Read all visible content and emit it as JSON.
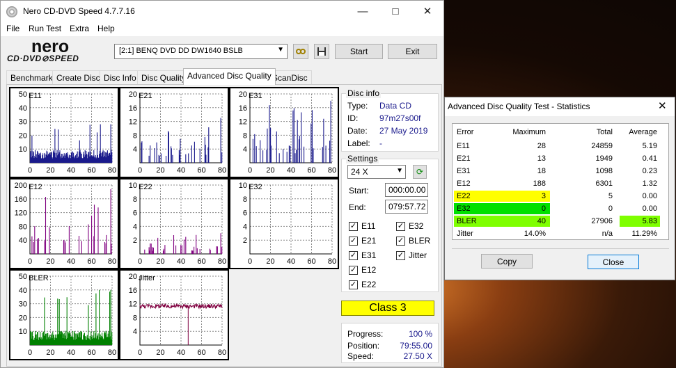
{
  "window": {
    "title": "Nero CD-DVD Speed 4.7.7.16"
  },
  "menu": [
    "File",
    "Run Test",
    "Extra",
    "Help"
  ],
  "logo": {
    "nero": "nero",
    "cdspeed": "CD·DVD⊘SPEED"
  },
  "toolbar": {
    "drive": "[2:1]   BENQ DVD DD DW1640 BSLB",
    "start": "Start",
    "exit": "Exit"
  },
  "tabs": [
    "Benchmark",
    "Create Disc",
    "Disc Info",
    "Disc Quality",
    "Advanced Disc Quality",
    "ScanDisc"
  ],
  "active_tab": 4,
  "disc_info": {
    "heading": "Disc info",
    "type_label": "Type:",
    "type": "Data CD",
    "id_label": "ID:",
    "id": "97m27s00f",
    "date_label": "Date:",
    "date": "27 May 2019",
    "label_label": "Label:",
    "label": "-"
  },
  "settings": {
    "heading": "Settings",
    "speed": "24 X",
    "start_label": "Start:",
    "start": "000:00.00",
    "end_label": "End:",
    "end": "079:57.72",
    "checks": [
      {
        "label": "E11",
        "checked": true
      },
      {
        "label": "E32",
        "checked": true
      },
      {
        "label": "E21",
        "checked": true
      },
      {
        "label": "BLER",
        "checked": true
      },
      {
        "label": "E31",
        "checked": true
      },
      {
        "label": "Jitter",
        "checked": true
      },
      {
        "label": "E12",
        "checked": true
      },
      {
        "label": "E22",
        "checked": true
      }
    ]
  },
  "class": "Class 3",
  "progress": {
    "progress_label": "Progress:",
    "progress": "100 %",
    "position_label": "Position:",
    "position": "79:55.00",
    "speed_label": "Speed:",
    "speed": "27.50 X"
  },
  "colors": {
    "navy": "#1a1a8c",
    "purple": "#800080",
    "green": "#008000",
    "maroon": "#800040",
    "yellow": "#ffff00",
    "brightgreen": "#00e000",
    "lime": "#7fff00"
  },
  "stats": {
    "title": "Advanced Disc Quality Test - Statistics",
    "headers": [
      "Error",
      "Maximum",
      "Total",
      "Average"
    ],
    "rows": [
      {
        "name": "E11",
        "max": "28",
        "total": "24859",
        "avg": "5.19"
      },
      {
        "name": "E21",
        "max": "13",
        "total": "1949",
        "avg": "0.41"
      },
      {
        "name": "E31",
        "max": "18",
        "total": "1098",
        "avg": "0.23"
      },
      {
        "name": "E12",
        "max": "188",
        "total": "6301",
        "avg": "1.32"
      },
      {
        "name": "E22",
        "max": "3",
        "total": "5",
        "avg": "0.00"
      },
      {
        "name": "E32",
        "max": "0",
        "total": "0",
        "avg": "0.00"
      },
      {
        "name": "BLER",
        "max": "40",
        "total": "27906",
        "avg": "5.83"
      },
      {
        "name": "Jitter",
        "max": "14.0%",
        "total": "n/a",
        "avg": "11.29%"
      }
    ],
    "copy": "Copy",
    "close": "Close"
  },
  "chart_data": [
    {
      "type": "bar",
      "name": "E11",
      "xlim": [
        0,
        80
      ],
      "ylim": [
        0,
        50
      ],
      "yticks": [
        10,
        20,
        30,
        40,
        50
      ],
      "xticks": [
        0,
        20,
        40,
        60,
        80
      ],
      "color": "#1a1a8c",
      "max": 28,
      "avg": 5.19
    },
    {
      "type": "bar",
      "name": "E21",
      "xlim": [
        0,
        80
      ],
      "ylim": [
        0,
        20
      ],
      "yticks": [
        4,
        8,
        12,
        16,
        20
      ],
      "xticks": [
        0,
        20,
        40,
        60,
        80
      ],
      "color": "#1a1a8c",
      "max": 13,
      "avg": 0.41
    },
    {
      "type": "bar",
      "name": "E31",
      "xlim": [
        0,
        80
      ],
      "ylim": [
        0,
        20
      ],
      "yticks": [
        4,
        8,
        12,
        16,
        20
      ],
      "xticks": [
        0,
        20,
        40,
        60,
        80
      ],
      "color": "#1a1a8c",
      "max": 18,
      "avg": 0.23
    },
    {
      "type": "bar",
      "name": "E12",
      "xlim": [
        0,
        80
      ],
      "ylim": [
        0,
        200
      ],
      "yticks": [
        40,
        80,
        120,
        160,
        200
      ],
      "xticks": [
        0,
        20,
        40,
        60,
        80
      ],
      "color": "#800080",
      "max": 188,
      "avg": 1.32
    },
    {
      "type": "bar",
      "name": "E22",
      "xlim": [
        0,
        80
      ],
      "ylim": [
        0,
        10
      ],
      "yticks": [
        2,
        4,
        6,
        8,
        10
      ],
      "xticks": [
        0,
        20,
        40,
        60,
        80
      ],
      "color": "#800080",
      "max": 3,
      "avg": 0
    },
    {
      "type": "bar",
      "name": "E32",
      "xlim": [
        0,
        80
      ],
      "ylim": [
        0,
        10
      ],
      "yticks": [
        2,
        4,
        6,
        8,
        10
      ],
      "xticks": [
        0,
        20,
        40,
        60,
        80
      ],
      "color": "#800080",
      "max": 0,
      "avg": 0
    },
    {
      "type": "bar",
      "name": "BLER",
      "xlim": [
        0,
        80
      ],
      "ylim": [
        0,
        50
      ],
      "yticks": [
        10,
        20,
        30,
        40,
        50
      ],
      "xticks": [
        0,
        20,
        40,
        60,
        80
      ],
      "color": "#008000",
      "max": 40,
      "avg": 5.83
    },
    {
      "type": "line",
      "name": "Jitter",
      "xlim": [
        0,
        80
      ],
      "ylim": [
        0,
        20
      ],
      "yticks": [
        4,
        8,
        12,
        16,
        20
      ],
      "xticks": [
        0,
        20,
        40,
        60,
        80
      ],
      "color": "#800040",
      "max": 14.0,
      "avg": 11.29
    }
  ]
}
